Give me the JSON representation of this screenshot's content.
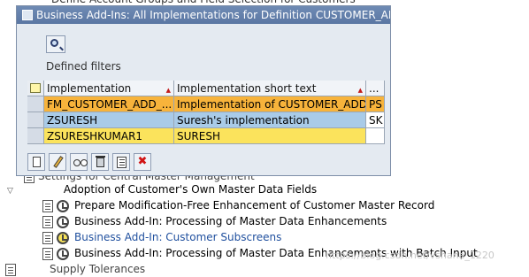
{
  "dialog": {
    "title": "Business Add-Ins: All Implementations for Definition CUSTOMER_ADD_DA",
    "defined_filters_label": "Defined filters",
    "columns": [
      "Implementation",
      "Implementation short text",
      "..."
    ],
    "rows": [
      {
        "implementation": "FM_CUSTOMER_ADD_...",
        "short_text": "Implementation of CUSTOMER_ADD...",
        "extra": "PS",
        "color": "#f7b33b"
      },
      {
        "implementation": "ZSURESH",
        "short_text": "Suresh's implementation",
        "extra": "SK",
        "color": "#a9cbe8"
      },
      {
        "implementation": "ZSURESHKUMAR1",
        "short_text": "SURESH",
        "extra": "",
        "color": "#fbe35c"
      }
    ],
    "toolbar_icons": [
      "create-icon",
      "change-icon",
      "display-icon",
      "delete-icon",
      "details-icon",
      "cancel-icon"
    ]
  },
  "tree": {
    "partial_top": "Define Account Groups and Field Selection for Customers",
    "partial_mid": "Settings for Central Master Management",
    "folder": "Adoption of Customer's Own Master Data Fields",
    "items": [
      "Prepare Modification-Free Enhancement of Customer Master Record",
      "Business Add-In: Processing of Master Data Enhancements",
      "Business Add-In: Customer Subscreens",
      "Business Add-In: Processing of Master Data Enhancements with Batch Input"
    ],
    "partial_bottom": "Supply Tolerances"
  },
  "watermark": "https://blog.csdn.net/vshana_1220"
}
